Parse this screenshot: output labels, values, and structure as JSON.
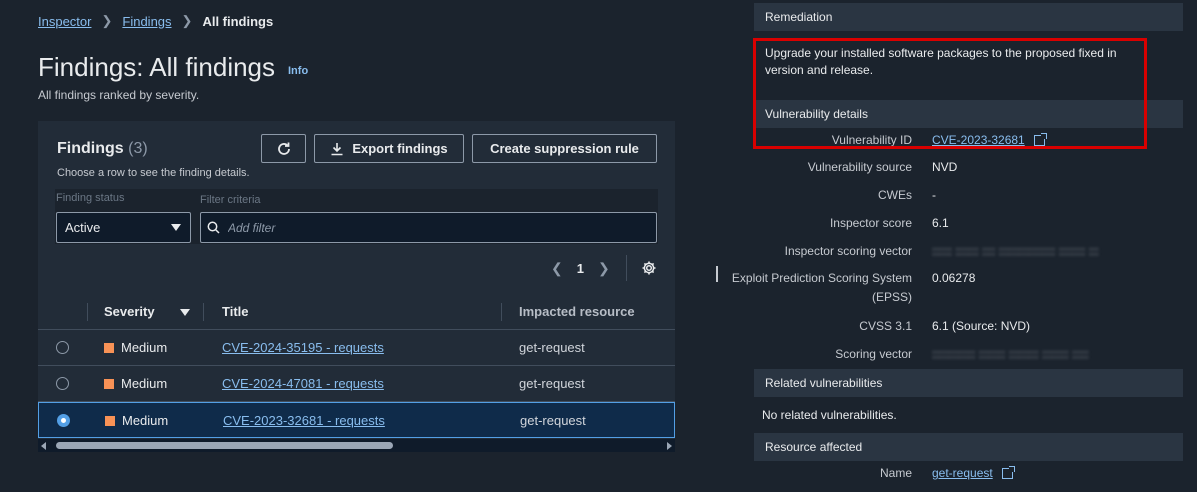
{
  "breadcrumb": {
    "items": [
      "Inspector",
      "Findings"
    ],
    "current": "All findings"
  },
  "page": {
    "title": "Findings: All findings",
    "info": "Info",
    "description": "All findings ranked by severity."
  },
  "panel": {
    "title": "Findings",
    "count": "(3)",
    "description": "Choose a row to see the finding details.",
    "export_label": "Export findings",
    "suppress_label": "Create suppression rule",
    "status_label": "Finding status",
    "status_value": "Active",
    "criteria_label": "Filter criteria",
    "filter_placeholder": "Add filter",
    "page_number": "1"
  },
  "table": {
    "headers": {
      "severity": "Severity",
      "title": "Title",
      "resource": "Impacted resource"
    },
    "rows": [
      {
        "severity": "Medium",
        "title": "CVE-2024-35195 - requests",
        "resource": "get-request",
        "selected": false
      },
      {
        "severity": "Medium",
        "title": "CVE-2024-47081 - requests",
        "resource": "get-request",
        "selected": false
      },
      {
        "severity": "Medium",
        "title": "CVE-2023-32681 - requests",
        "resource": "get-request",
        "selected": true
      }
    ]
  },
  "details": {
    "remediation_header": "Remediation",
    "remediation_text": "Upgrade your installed software packages to the proposed fixed in version and release.",
    "vuln_header": "Vulnerability details",
    "vulnerability_id_label": "Vulnerability ID",
    "vulnerability_id": "CVE-2023-32681",
    "vulnerability_source_label": "Vulnerability source",
    "vulnerability_source": "NVD",
    "cwes_label": "CWEs",
    "cwes": "-",
    "inspector_score_label": "Inspector score",
    "inspector_score": "6.1",
    "scoring_vector_label": "Inspector scoring vector",
    "epss_label": "Exploit Prediction Scoring System (EPSS)",
    "epss": "0.06278",
    "cvss_label": "CVSS 3.1",
    "cvss": "6.1 (Source: NVD)",
    "vector_label": "Scoring vector",
    "related_header": "Related vulnerabilities",
    "related_text": "No related vulnerabilities.",
    "resource_header": "Resource affected",
    "name_label": "Name",
    "name_value": "get-request"
  },
  "colors": {
    "severity_medium": "#f89256",
    "link": "#89bdee",
    "highlight": "#d90000",
    "selected_border": "#539fe5"
  }
}
